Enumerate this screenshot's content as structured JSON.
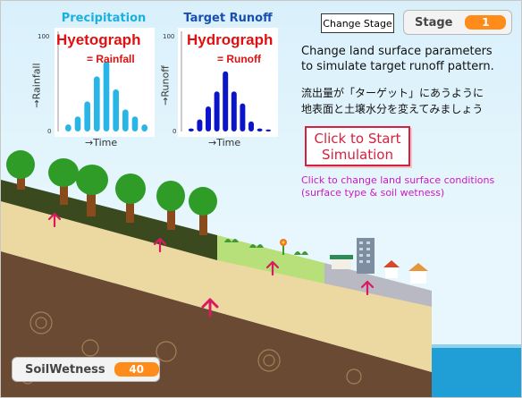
{
  "precipitation_panel": {
    "title": "Precipitation",
    "heading": "Hyetograph",
    "subheading": "= Rainfall",
    "ylabel": "→Rainfall",
    "xlabel": "→Time",
    "y_top": "100",
    "y_zero": "0"
  },
  "runoff_panel": {
    "title": "Target Runoff",
    "heading": "Hydrograph",
    "subheading": "= Runoff",
    "ylabel": "→Runoff",
    "xlabel": "→Time",
    "y_top": "100",
    "y_zero": "0"
  },
  "controls": {
    "change_stage_label": "Change Stage",
    "stage_label": "Stage",
    "stage_value": "1",
    "start_line1": "Click to Start",
    "start_line2": "Simulation"
  },
  "instructions": {
    "en_line1": "Change land surface parameters",
    "en_line2": "to simulate target runoff pattern.",
    "ja_line1": "流出量が「ターゲット」にあうように",
    "ja_line2": "地表面と土壌水分を変えてみましょう",
    "hint_line1": "Click to change land surface conditions",
    "hint_line2": "(surface type & soil wetness)"
  },
  "soil_wetness": {
    "label": "SoilWetness",
    "value": "40"
  },
  "colors": {
    "rain_bar": "#29b6e6",
    "runoff_bar": "#0b14c8",
    "accent_red": "#e01010",
    "stage_orange": "#ff8c1a",
    "hint_magenta": "#d216c6",
    "arrow_pink": "#d81b60"
  },
  "chart_data": [
    {
      "type": "bar",
      "title": "Hyetograph",
      "xlabel": "→Time",
      "ylabel": "→Rainfall",
      "ylim": [
        0,
        100
      ],
      "series": [
        {
          "name": "Rainfall",
          "values": [
            7,
            15,
            30,
            55,
            70,
            42,
            22,
            15,
            7
          ]
        }
      ]
    },
    {
      "type": "bar",
      "title": "Hydrograph",
      "xlabel": "→Time",
      "ylabel": "→Runoff",
      "ylim": [
        0,
        100
      ],
      "series": [
        {
          "name": "Runoff",
          "values": [
            3,
            12,
            25,
            40,
            60,
            40,
            28,
            10,
            3,
            2
          ]
        }
      ]
    }
  ]
}
